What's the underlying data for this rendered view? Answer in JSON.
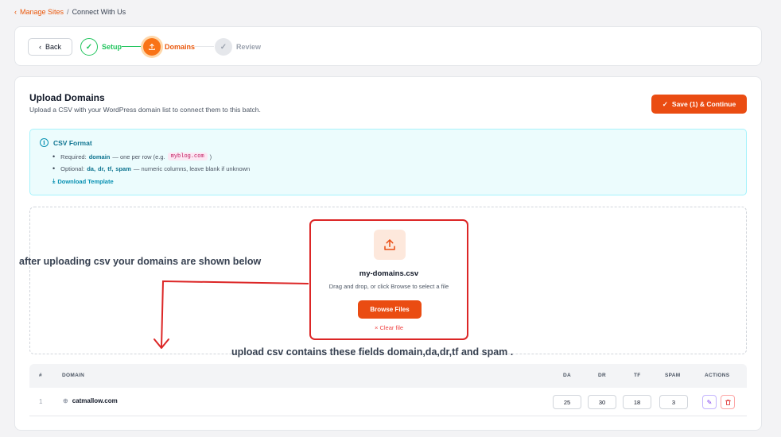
{
  "breadcrumb": {
    "parent": "Manage Sites",
    "separator": "/",
    "current": "Connect With Us"
  },
  "stepper": {
    "back_label": "Back",
    "steps": [
      {
        "label": "Setup",
        "state": "done"
      },
      {
        "label": "Domains",
        "state": "active"
      },
      {
        "label": "Review",
        "state": "todo"
      }
    ]
  },
  "upload": {
    "title": "Upload Domains",
    "subtitle": "Upload a CSV with your WordPress domain list to connect them to this batch.",
    "save_label": "Save (1) & Continue"
  },
  "csv_format": {
    "heading": "CSV Format",
    "required_label": "Required:",
    "required_field": "domain",
    "required_desc": "— one per row (e.g.",
    "required_example": "myblog.com",
    "required_close": ")",
    "optional_label": "Optional:",
    "optional_fields": [
      "da,",
      "dr,",
      "tf,",
      "spam"
    ],
    "optional_desc": "— numeric columns, leave blank if unknown",
    "download_label": "Download Template"
  },
  "dropzone": {
    "file_name": "my-domains.csv",
    "hint": "Drag and drop, or click Browse to select a file",
    "browse_label": "Browse Files",
    "clear_label": "Clear file"
  },
  "annotations": {
    "note1": "after uploading csv your domains are shown below",
    "note2": "upload csv contains these fields domain,da,dr,tf and spam ."
  },
  "table": {
    "headers": {
      "num": "#",
      "domain": "DOMAIN",
      "da": "DA",
      "dr": "DR",
      "tf": "TF",
      "spam": "SPAM",
      "actions": "ACTIONS"
    },
    "rows": [
      {
        "num": "1",
        "domain": "catmallow.com",
        "da": "25",
        "dr": "30",
        "tf": "18",
        "spam": "3"
      }
    ]
  },
  "colors": {
    "accent": "#ea4c12",
    "success": "#22c55e",
    "info": "#0891b2",
    "annotation": "#dc2626"
  }
}
